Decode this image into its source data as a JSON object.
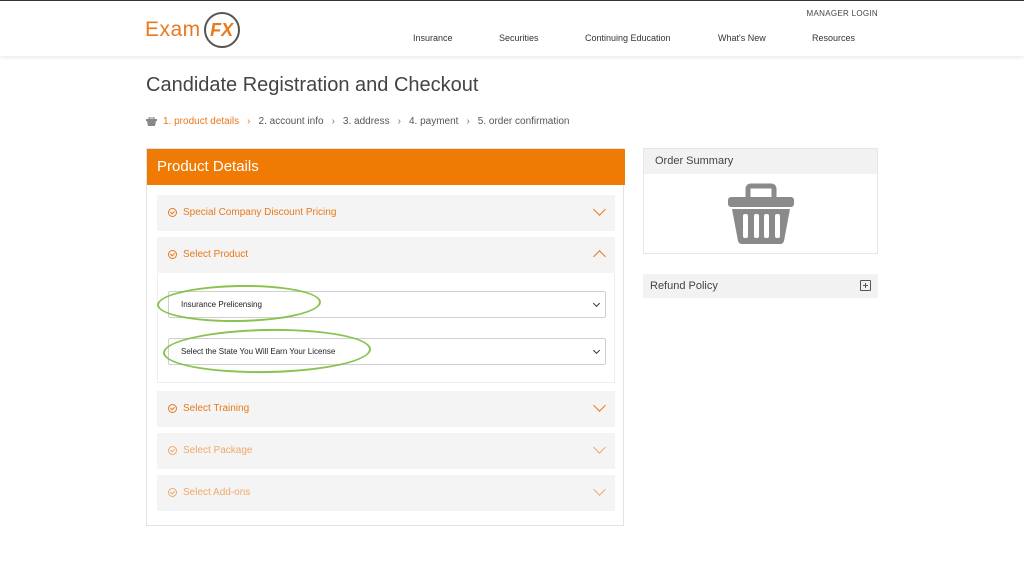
{
  "header": {
    "logo": {
      "exam": "Exam",
      "fx": "FX"
    },
    "manager_login": "MANAGER LOGIN",
    "nav": [
      "Insurance",
      "Securities",
      "Continuing Education",
      "What's New",
      "Resources"
    ]
  },
  "page": {
    "title": "Candidate Registration and Checkout",
    "steps": [
      "1. product details",
      "2. account info",
      "3. address",
      "4. payment",
      "5. order confirmation"
    ],
    "active_step": 0
  },
  "product_details": {
    "title": "Product Details",
    "sections": [
      {
        "label": "Special Company Discount Pricing",
        "state": "collapsed"
      },
      {
        "label": "Select Product",
        "state": "expanded"
      },
      {
        "label": "Select Training",
        "state": "collapsed"
      },
      {
        "label": "Select Package",
        "state": "disabled"
      },
      {
        "label": "Select Add-ons",
        "state": "disabled"
      }
    ],
    "product_select": {
      "value": "Insurance Prelicensing"
    },
    "state_select": {
      "value": "Select the State You Will Earn Your License"
    }
  },
  "order_summary": {
    "title": "Order Summary",
    "icon": "basket-icon"
  },
  "refund_policy": {
    "title": "Refund Policy",
    "icon": "plus-square-icon"
  },
  "colors": {
    "accent": "#ef7b05",
    "annotation": "#7dbb3c",
    "panel_bg": "#f4f4f4"
  }
}
